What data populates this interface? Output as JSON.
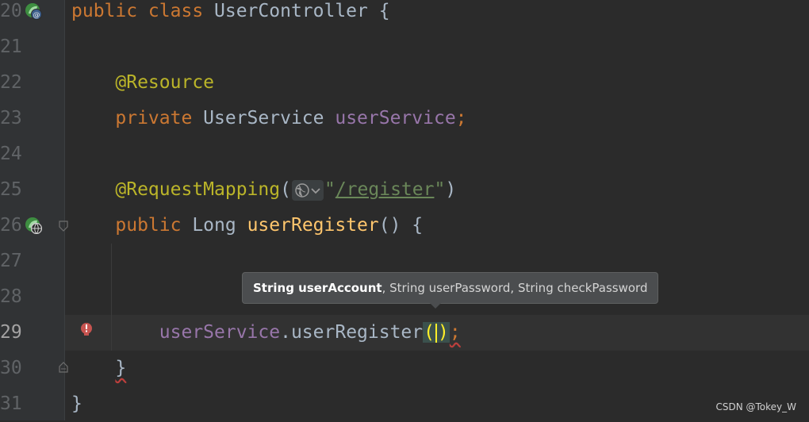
{
  "editor": {
    "lines": [
      {
        "num": "20",
        "tokens": [
          {
            "t": "public class ",
            "c": "kw"
          },
          {
            "t": "UserController {",
            "c": "plain"
          }
        ]
      },
      {
        "num": "21",
        "tokens": []
      },
      {
        "num": "22",
        "tokens": [
          {
            "t": "    @Resource",
            "c": "ann"
          }
        ]
      },
      {
        "num": "23",
        "tokens": [
          {
            "t": "    private ",
            "c": "kw"
          },
          {
            "t": "UserService ",
            "c": "plain"
          },
          {
            "t": "userService",
            "c": "field"
          },
          {
            "t": ";",
            "c": "kw"
          }
        ]
      },
      {
        "num": "24",
        "tokens": []
      },
      {
        "num": "25",
        "tokens": [
          {
            "t": "    @RequestMapping",
            "c": "ann"
          },
          {
            "t": "(",
            "c": "plain"
          },
          {
            "inlay": true
          },
          {
            "t": "\"",
            "c": "str"
          },
          {
            "t": "/register",
            "c": "str-u"
          },
          {
            "t": "\"",
            "c": "str"
          },
          {
            "t": ")",
            "c": "plain"
          }
        ]
      },
      {
        "num": "26",
        "tokens": [
          {
            "t": "    public ",
            "c": "kw"
          },
          {
            "t": "Long ",
            "c": "plain"
          },
          {
            "t": "userRegister",
            "c": "method"
          },
          {
            "t": "() {",
            "c": "plain"
          }
        ]
      },
      {
        "num": "27",
        "tokens": []
      },
      {
        "num": "28",
        "tokens": []
      },
      {
        "num": "29",
        "current": true,
        "tokens": [
          {
            "t": "        ",
            "c": "plain"
          },
          {
            "t": "userService",
            "c": "field"
          },
          {
            "t": ".userRegister",
            "c": "plain"
          },
          {
            "paren": true
          },
          {
            "t": ";",
            "c": "kw squiggle"
          }
        ]
      },
      {
        "num": "30",
        "tokens": [
          {
            "t": "    ",
            "c": "plain"
          },
          {
            "t": "}",
            "c": "plain squiggle"
          }
        ]
      },
      {
        "num": "31",
        "tokens": [
          {
            "t": "}",
            "c": "plain"
          }
        ]
      }
    ]
  },
  "tooltip": {
    "bold": "String userAccount",
    "rest": ", String userPassword, String checkPassword"
  },
  "gutter_icons": {
    "line20": "spring-bean-icon",
    "line26": "spring-web-icon",
    "line29": "error-bulb-icon"
  },
  "watermark": "CSDN @Tokey_W",
  "colors": {
    "background": "#2b2b2b",
    "keyword": "#cc7832",
    "annotation": "#bbb529",
    "field": "#9876aa",
    "method": "#ffc66d",
    "string": "#6a8759",
    "text": "#a9b7c6"
  }
}
